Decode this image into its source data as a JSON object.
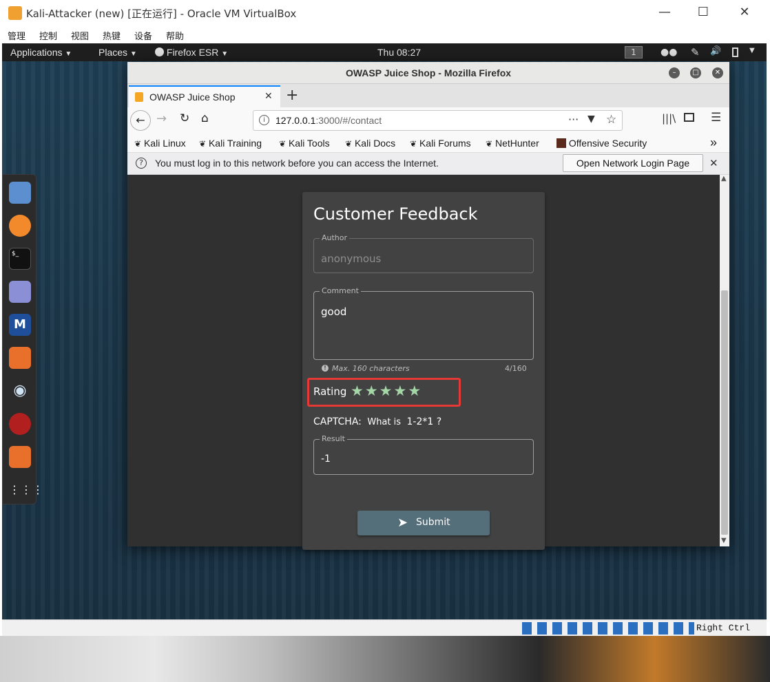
{
  "vbox": {
    "title": "Kali-Attacker (new) [正在运行] - Oracle VM VirtualBox",
    "menu": [
      "管理",
      "控制",
      "视图",
      "热键",
      "设备",
      "帮助"
    ],
    "status_host_key": "Right Ctrl"
  },
  "topbar": {
    "applications": "Applications",
    "places": "Places",
    "firefox": "Firefox ESR",
    "clock": "Thu 08:27",
    "workspace": "1"
  },
  "firefox": {
    "window_title": "OWASP Juice Shop - Mozilla Firefox",
    "tab_title": "OWASP Juice Shop",
    "url_host": "127.0.0.1",
    "url_rest": ":3000/#/contact",
    "bookmarks": [
      "Kali Linux",
      "Kali Training",
      "Kali Tools",
      "Kali Docs",
      "Kali Forums",
      "NetHunter",
      "Offensive Security"
    ],
    "notice_text": "You must log in to this network before you can access the Internet.",
    "notice_button": "Open Network Login Page"
  },
  "feedback": {
    "title": "Customer Feedback",
    "author_label": "Author",
    "author_value": "anonymous",
    "comment_label": "Comment",
    "comment_value": "good",
    "hint": "Max. 160 characters",
    "counter": "4/160",
    "rating_label": "Rating",
    "rating_stars": 5,
    "captcha_label": "CAPTCHA:",
    "captcha_question": "What is",
    "captcha_expr": "1-2*1",
    "captcha_q_mark": "?",
    "result_label": "Result",
    "result_value": "-1",
    "submit_label": "Submit"
  },
  "colors": {
    "star": "#a5d6a7",
    "highlight_box": "#e53935",
    "submit_bg": "#546e7a"
  }
}
